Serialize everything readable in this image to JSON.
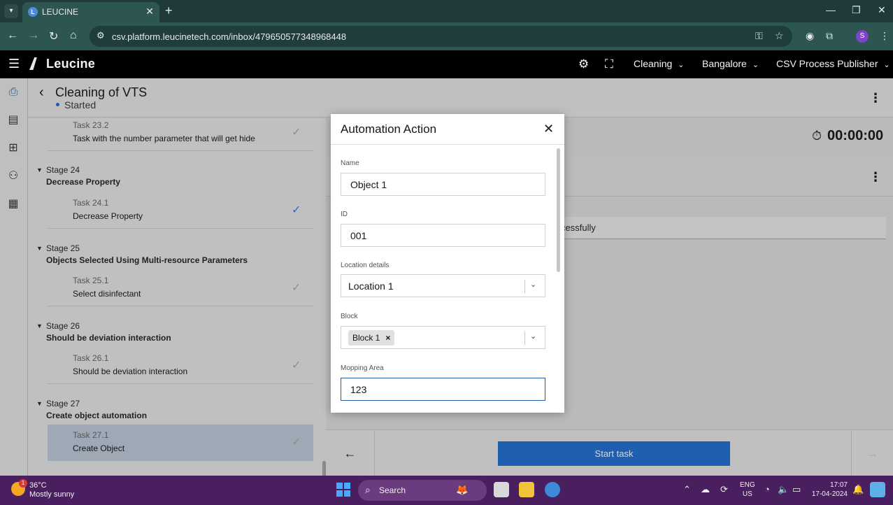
{
  "browser": {
    "tab_title": "LEUCINE",
    "url": "csv.platform.leucinetech.com/inbox/479650577348968448",
    "profile_initial": "S"
  },
  "app": {
    "brand": "Leucine",
    "dropdowns": [
      "Cleaning",
      "Bangalore",
      "CSV Process Publisher"
    ]
  },
  "job": {
    "title": "Cleaning of VTS",
    "status": "Started",
    "timer": "00:00:00"
  },
  "stages": [
    {
      "task_number": "Task 23.2",
      "task_name": "Task with the number parameter that will get hide"
    },
    {
      "stage_number": "Stage 24",
      "stage_name": "Decrease Property",
      "task_number": "Task 24.1",
      "task_name": "Decrease Property"
    },
    {
      "stage_number": "Stage 25",
      "stage_name": "Objects Selected Using Multi-resource Parameters",
      "task_number": "Task 25.1",
      "task_name": "Select disinfectant"
    },
    {
      "stage_number": "Stage 26",
      "stage_name": "Should be deviation interaction",
      "task_number": "Task 26.1",
      "task_name": "Should be deviation interaction"
    },
    {
      "stage_number": "Stage 27",
      "stage_name": "Create object automation",
      "task_number": "Task 27.1",
      "task_name": "Create Object"
    }
  ],
  "right_pane": {
    "success_text": "cessfully",
    "start_button": "Start task"
  },
  "modal": {
    "title": "Automation Action",
    "fields": {
      "name_label": "Name",
      "name_value": "Object 1",
      "id_label": "ID",
      "id_value": "001",
      "location_label": "Location details",
      "location_value": "Location 1",
      "block_label": "Block",
      "block_chip": "Block 1",
      "mopping_label": "Mopping Area",
      "mopping_value": "123"
    }
  },
  "taskbar": {
    "weather_badge": "1",
    "temperature": "36°C",
    "weather_desc": "Mostly sunny",
    "search_placeholder": "Search",
    "lang_top": "ENG",
    "lang_bottom": "US",
    "time": "17:07",
    "date": "17-04-2024"
  },
  "colors": {
    "primary": "#1f5fb0",
    "app_header": "#000000",
    "taskbar": "#4a1f5f"
  }
}
